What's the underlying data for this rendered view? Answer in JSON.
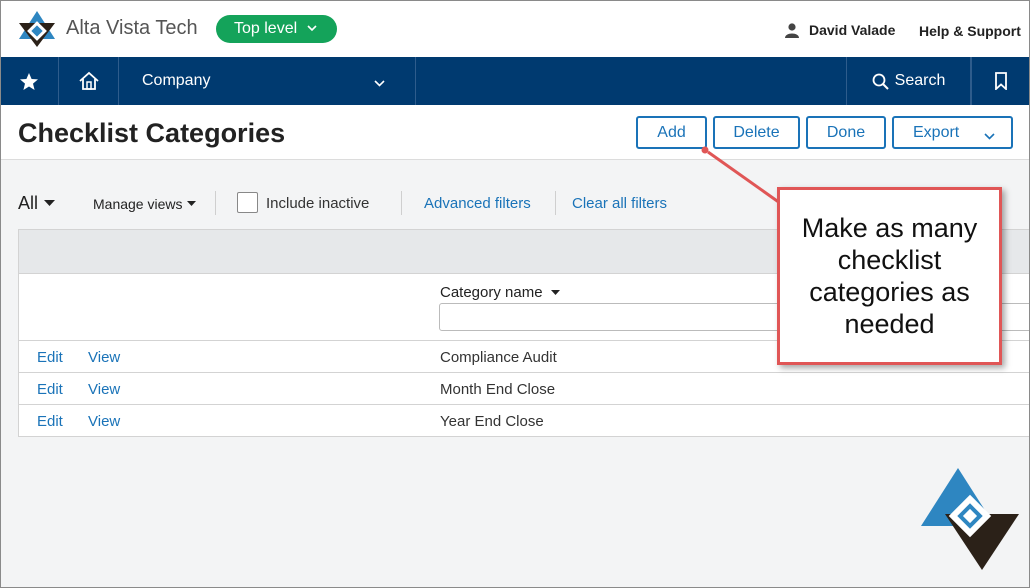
{
  "header": {
    "company_name": "Alta Vista Tech",
    "level_label": "Top level",
    "user_name": "David Valade",
    "help_label": "Help & Support"
  },
  "nav": {
    "favorites_icon": "star-icon",
    "home_icon": "home-icon",
    "company_label": "Company",
    "search_label": "Search",
    "bookmark_icon": "bookmark-icon"
  },
  "page": {
    "title": "Checklist Categories",
    "buttons": {
      "add": "Add",
      "delete": "Delete",
      "done": "Done",
      "export": "Export"
    }
  },
  "filters": {
    "view_label": "All",
    "manage_views": "Manage views",
    "include_inactive": "Include inactive",
    "advanced_filters": "Advanced filters",
    "clear_all_filters": "Clear all filters"
  },
  "table": {
    "column_header": "Category name",
    "rows": [
      {
        "edit": "Edit",
        "view": "View",
        "name": "Compliance Audit"
      },
      {
        "edit": "Edit",
        "view": "View",
        "name": "Month End Close"
      },
      {
        "edit": "Edit",
        "view": "View",
        "name": "Year End Close"
      }
    ]
  },
  "callout": {
    "text": "Make as many checklist categories as needed"
  },
  "colors": {
    "nav_bg": "#003a70",
    "accent_blue": "#1a73b8",
    "pill_green": "#14a35a",
    "callout_red": "#e05656"
  }
}
